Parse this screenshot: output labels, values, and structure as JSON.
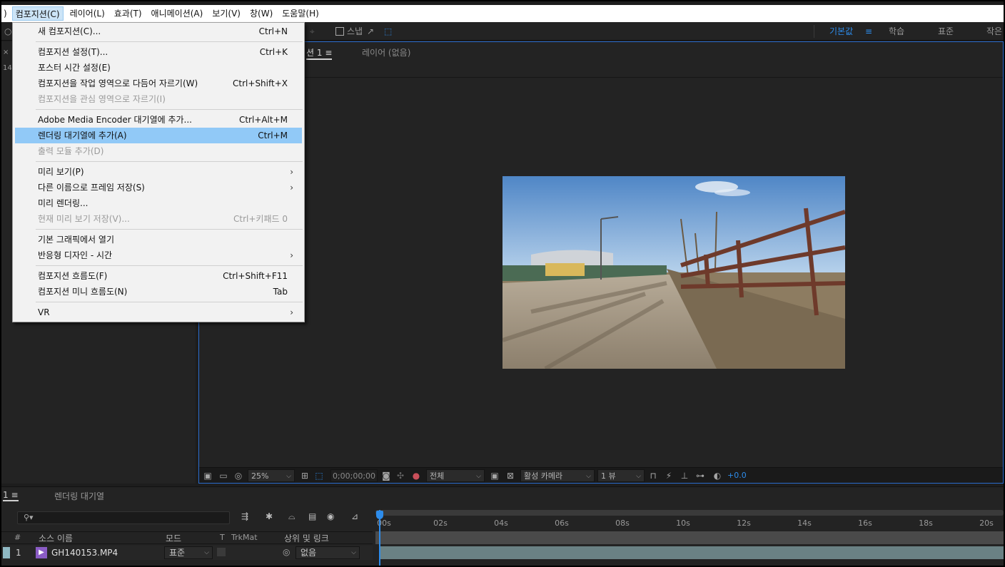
{
  "menubar": {
    "items": [
      {
        "label": ")"
      },
      {
        "label": "컴포지션(C)"
      },
      {
        "label": "레이어(L)"
      },
      {
        "label": "효과(T)"
      },
      {
        "label": "애니메이션(A)"
      },
      {
        "label": "보기(V)"
      },
      {
        "label": "창(W)"
      },
      {
        "label": "도움말(H)"
      }
    ]
  },
  "toolbar": {
    "snap_label": "스냅",
    "workspaces": [
      "기본값",
      "학습",
      "표준",
      "작은"
    ]
  },
  "left_panel": {
    "tag_top": "×",
    "tag_bottom": "14("
  },
  "viewer": {
    "tab_comp": "션 1",
    "tab_layer": "레이어 (없음)"
  },
  "viewer_bar": {
    "zoom": "25%",
    "timecode": "0;00;00;00",
    "resolution": "전체",
    "camera": "활성 카메라",
    "views": "1 뷰",
    "exposure": "+0.0"
  },
  "dropdown": {
    "items": [
      {
        "label": "새 컴포지션(C)...",
        "shortcut": "Ctrl+N"
      },
      {
        "label": "컴포지션 설정(T)...",
        "shortcut": "Ctrl+K"
      },
      {
        "label": "포스터 시간 설정(E)",
        "shortcut": ""
      },
      {
        "label": "컴포지션을 작업 영역으로 다듬어 자르기(W)",
        "shortcut": "Ctrl+Shift+X"
      },
      {
        "label": "컴포지션을 관심 영역으로 자르기(I)",
        "shortcut": ""
      },
      {
        "label": "Adobe Media Encoder 대기열에 추가...",
        "shortcut": "Ctrl+Alt+M"
      },
      {
        "label": "렌더링 대기열에 추가(A)",
        "shortcut": "Ctrl+M"
      },
      {
        "label": "출력 모듈 추가(D)",
        "shortcut": ""
      },
      {
        "label": "미리 보기(P)",
        "shortcut": ""
      },
      {
        "label": "다른 이름으로 프레임 저장(S)",
        "shortcut": ""
      },
      {
        "label": "미리 렌더링...",
        "shortcut": ""
      },
      {
        "label": "현재 미리 보기 저장(V)...",
        "shortcut": "Ctrl+키패드 0"
      },
      {
        "label": "기본 그래픽에서 열기",
        "shortcut": ""
      },
      {
        "label": "반응형 디자인 - 시간",
        "shortcut": ""
      },
      {
        "label": "컴포지션 흐름도(F)",
        "shortcut": "Ctrl+Shift+F11"
      },
      {
        "label": "컴포지션 미니 흐름도(N)",
        "shortcut": "Tab"
      },
      {
        "label": "VR",
        "shortcut": ""
      }
    ]
  },
  "timeline": {
    "tab_comp": "1",
    "tab_render": "렌더링 대기열",
    "search_placeholder": "",
    "ruler_ticks": [
      "00s",
      "02s",
      "04s",
      "06s",
      "08s",
      "10s",
      "12s",
      "14s",
      "16s",
      "18s",
      "20s"
    ],
    "columns": {
      "num": "#",
      "source": "소스 이름",
      "mode": "모드",
      "t": "T",
      "trkmat": "TrkMat",
      "parent": "상위 및 링크"
    },
    "layer": {
      "index": "1",
      "name": "GH140153.MP4",
      "mode": "표준",
      "parent": "없음"
    }
  }
}
